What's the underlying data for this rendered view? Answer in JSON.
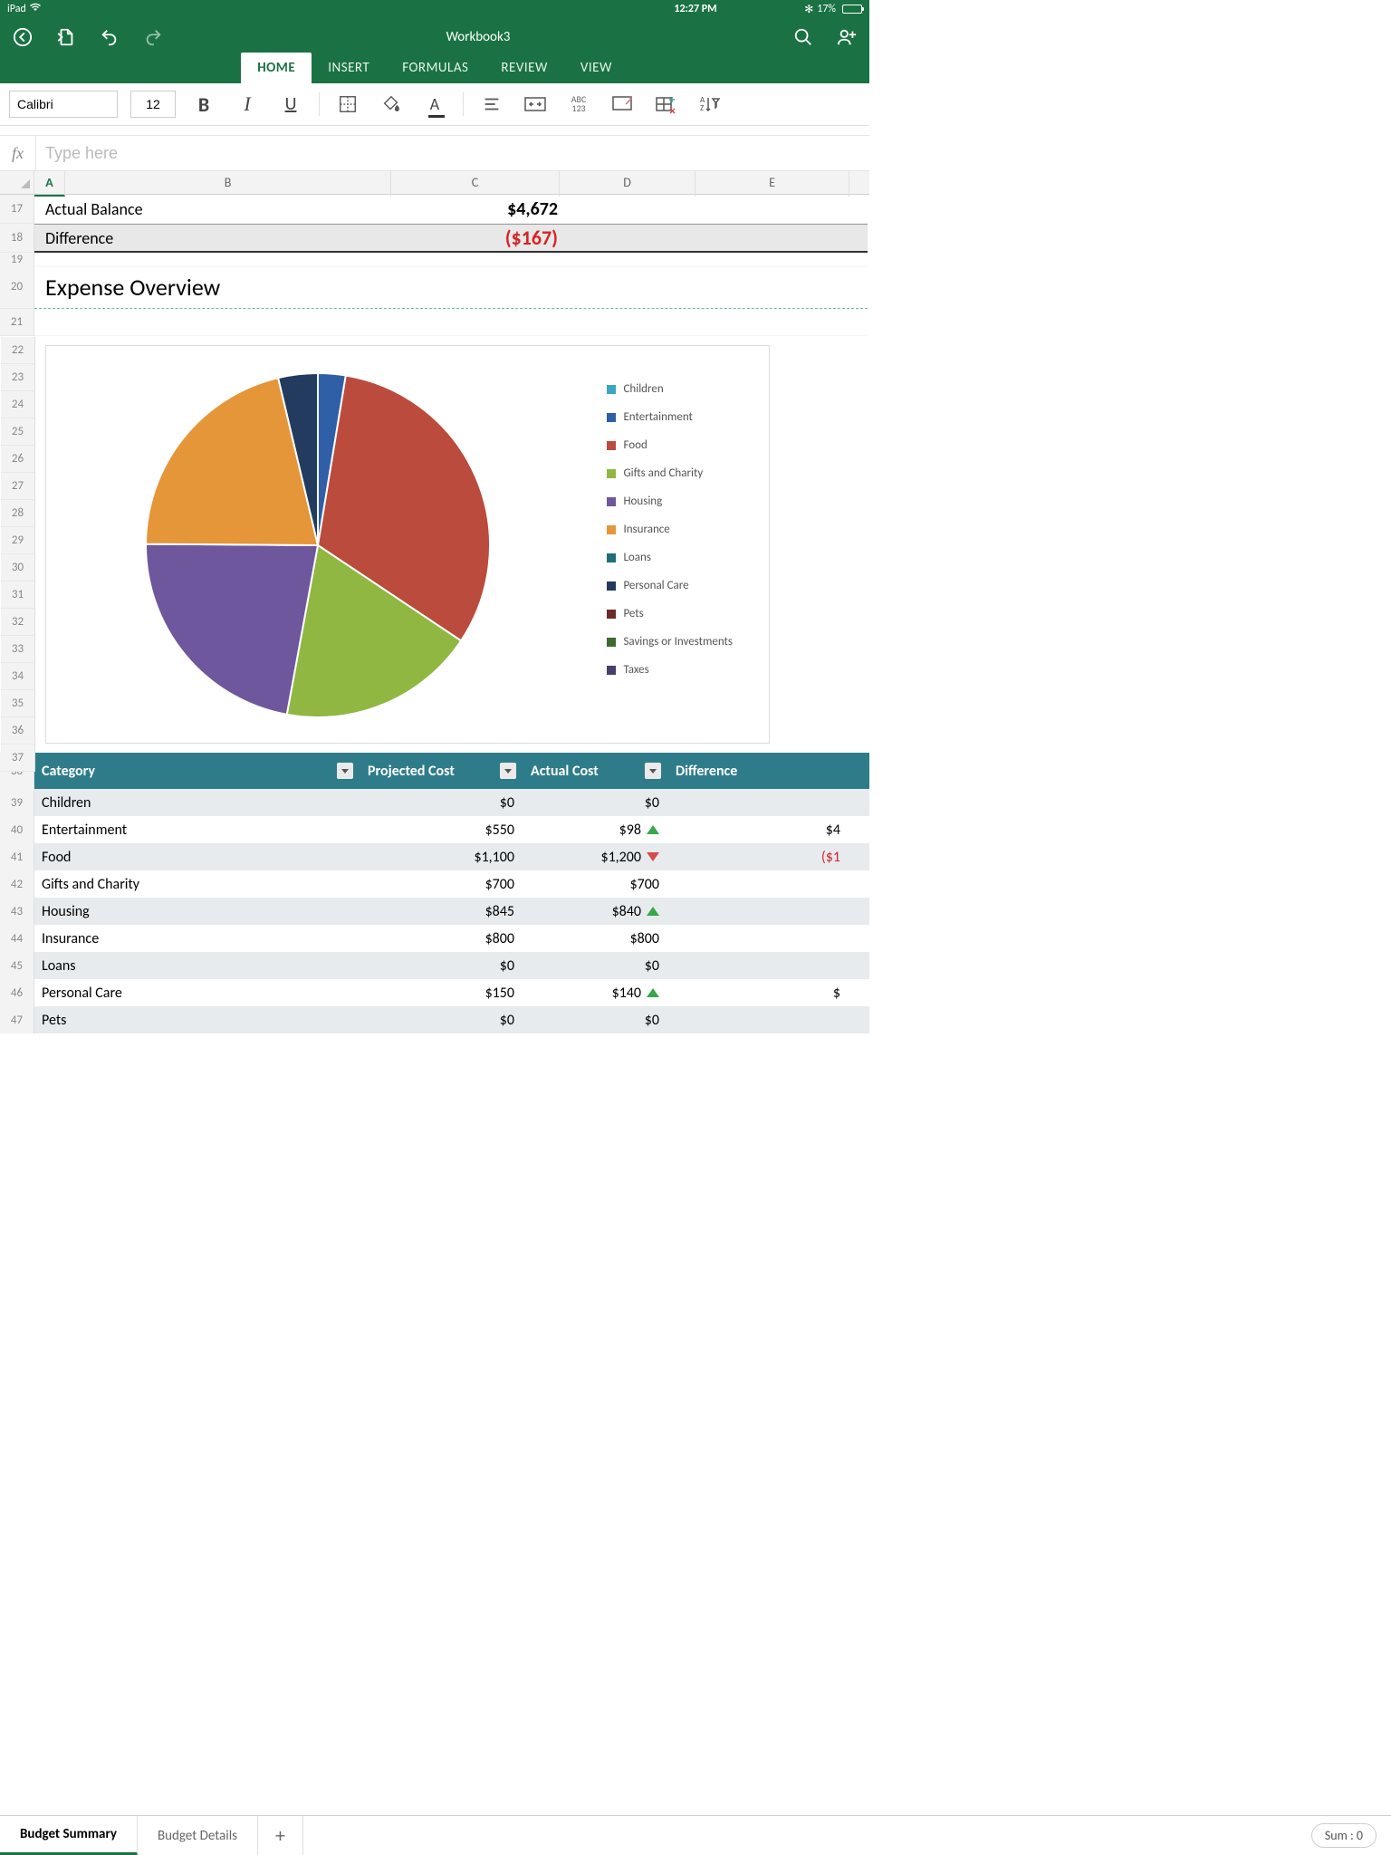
{
  "status_bar": {
    "device": "iPad",
    "time": "12:27 PM",
    "battery_text": "17%"
  },
  "app": {
    "title": "Workbook3",
    "tabs": [
      "HOME",
      "INSERT",
      "FORMULAS",
      "REVIEW",
      "VIEW"
    ],
    "active_tab": "HOME"
  },
  "ribbon": {
    "font_family": "Calibri",
    "font_size": "12"
  },
  "formula_bar": {
    "placeholder": "Type here"
  },
  "columns": [
    "A",
    "B",
    "C",
    "D",
    "E"
  ],
  "summary": {
    "actual_balance_label": "Actual Balance",
    "actual_balance_value": "$4,672",
    "difference_label": "Difference",
    "difference_value": "($167)"
  },
  "section_title": "Expense Overview",
  "chart_data": {
    "type": "pie",
    "title": "",
    "legend_position": "right",
    "categories": [
      "Children",
      "Entertainment",
      "Food",
      "Gifts and Charity",
      "Housing",
      "Insurance",
      "Loans",
      "Personal Care",
      "Pets",
      "Savings or Investments",
      "Taxes"
    ],
    "values": [
      0,
      98,
      1200,
      700,
      840,
      800,
      0,
      140,
      0,
      0,
      0
    ],
    "colors": [
      "#3aa6c4",
      "#2f5fa6",
      "#bb4b3c",
      "#8fb742",
      "#6f579e",
      "#e59638",
      "#1e6f77",
      "#223b5e",
      "#6b2d25",
      "#3d6b2f",
      "#4a3f6b"
    ]
  },
  "table": {
    "headers": [
      "Category",
      "Projected Cost",
      "Actual Cost",
      "Difference"
    ],
    "rows": [
      {
        "row": 39,
        "category": "Children",
        "projected": "$0",
        "actual": "$0",
        "indicator": "",
        "diff": ""
      },
      {
        "row": 40,
        "category": "Entertainment",
        "projected": "$550",
        "actual": "$98",
        "indicator": "up",
        "diff": "$4"
      },
      {
        "row": 41,
        "category": "Food",
        "projected": "$1,100",
        "actual": "$1,200",
        "indicator": "down",
        "diff": "($1"
      },
      {
        "row": 42,
        "category": "Gifts and Charity",
        "projected": "$700",
        "actual": "$700",
        "indicator": "",
        "diff": ""
      },
      {
        "row": 43,
        "category": "Housing",
        "projected": "$845",
        "actual": "$840",
        "indicator": "up",
        "diff": ""
      },
      {
        "row": 44,
        "category": "Insurance",
        "projected": "$800",
        "actual": "$800",
        "indicator": "",
        "diff": ""
      },
      {
        "row": 45,
        "category": "Loans",
        "projected": "$0",
        "actual": "$0",
        "indicator": "",
        "diff": ""
      },
      {
        "row": 46,
        "category": "Personal Care",
        "projected": "$150",
        "actual": "$140",
        "indicator": "up",
        "diff": "$"
      },
      {
        "row": 47,
        "category": "Pets",
        "projected": "$0",
        "actual": "$0",
        "indicator": "",
        "diff": ""
      }
    ]
  },
  "sheet_tabs": {
    "items": [
      "Budget Summary",
      "Budget Details"
    ],
    "active": 0
  },
  "status": {
    "sum_label": "Sum : 0"
  }
}
